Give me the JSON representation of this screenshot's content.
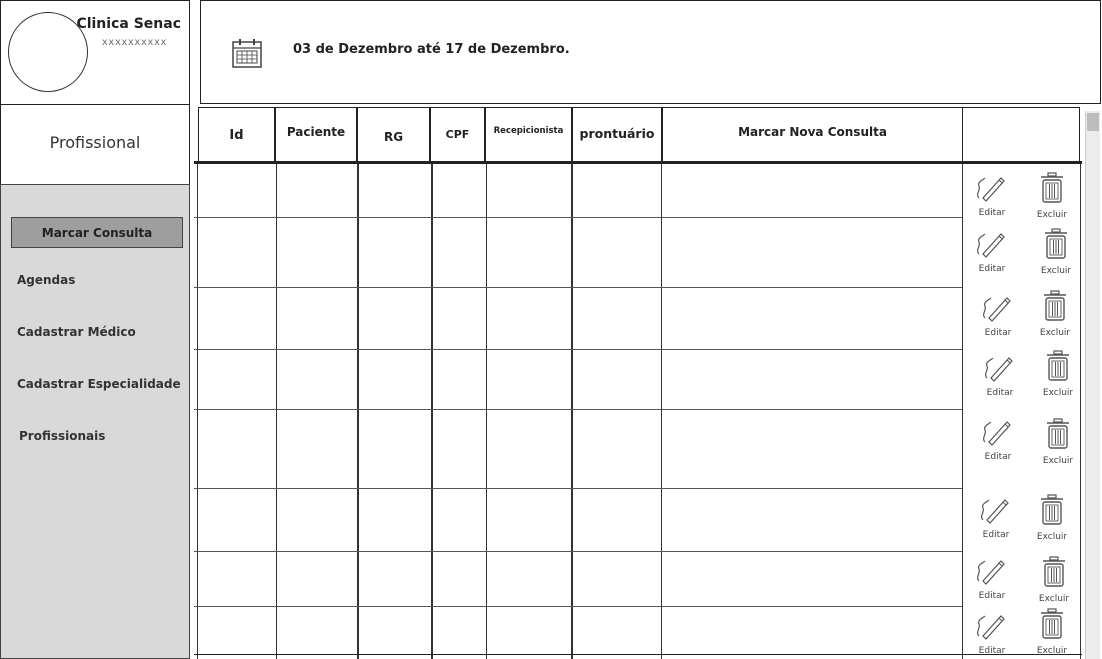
{
  "clinic": {
    "name": "Clinica Senac",
    "subtitle": "xxxxxxxxxx"
  },
  "date_range": "03 de Dezembro até  17 de Dezembro.",
  "profile_title": "Profissional",
  "sidebar": {
    "active": "Marcar Consulta",
    "links": [
      "Agendas",
      "Cadastrar Médico",
      "Cadastrar Especialidade",
      "Profissionais"
    ]
  },
  "table": {
    "headers": [
      "Id",
      "Paciente",
      "RG",
      "CPF",
      "Recepicionista",
      "prontuário",
      "Marcar Nova Consulta",
      ""
    ]
  },
  "actions": {
    "edit": "Editar",
    "delete": "Excluir"
  },
  "icons": [
    "calendar-icon",
    "pencil-icon",
    "trash-icon"
  ]
}
